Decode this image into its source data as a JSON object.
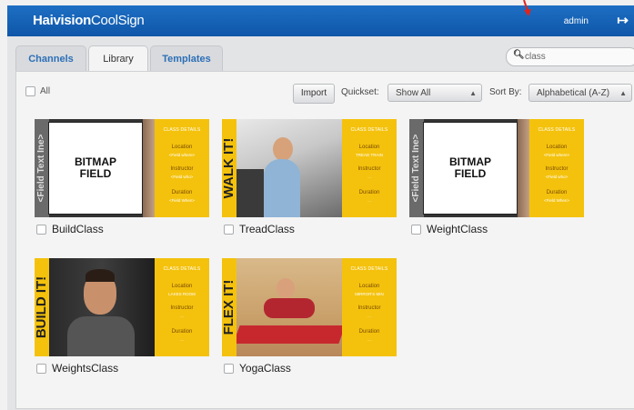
{
  "app": {
    "brand_bold": "Haivision",
    "brand_light": "CoolSign",
    "user": "admin"
  },
  "tabs": [
    {
      "label": "Channels",
      "active": false
    },
    {
      "label": "Library",
      "active": true
    },
    {
      "label": "Templates",
      "active": false
    }
  ],
  "search": {
    "value": "class"
  },
  "toolbar": {
    "all_label": "All",
    "import_label": "Import",
    "quickset_label": "Quickset:",
    "quickset_value": "Show All",
    "sortby_label": "Sort By:",
    "sortby_value": "Alphabetical (A-Z)"
  },
  "card_side": {
    "header": "CLASS DETAILS",
    "location_label": "Location",
    "instructor_label": "Instructor",
    "duration_label": "Duration"
  },
  "items": [
    {
      "name": "BuildClass",
      "strip": "<Field Text Ine>",
      "bitmap": "BITMAP\nFIELD",
      "location": "<Field where>",
      "instructor": "<Field who>",
      "duration": "<Field When>"
    },
    {
      "name": "TreadClass",
      "strip": "WALK IT!",
      "location": "TREAD TRAIN",
      "instructor": "...",
      "duration": "..."
    },
    {
      "name": "WeightClass",
      "strip": "<Field Text Ine>",
      "bitmap": "BITMAP\nFIELD",
      "location": "<Field where>",
      "instructor": "<Field who>",
      "duration": "<Field When>"
    },
    {
      "name": "WeightsClass",
      "strip": "BUILD IT!",
      "location": "LAKES ROOM",
      "instructor": "...",
      "duration": "..."
    },
    {
      "name": "YogaClass",
      "strip": "FLEX IT!",
      "location": "MIRROR'S MIN",
      "instructor": "...",
      "duration": "..."
    }
  ],
  "colors": {
    "brand_bar": "#1565be",
    "accent_yellow": "#f4c20d",
    "tab_link": "#2d6fb7"
  }
}
